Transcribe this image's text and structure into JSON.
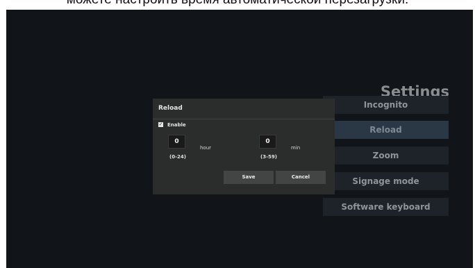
{
  "caption": "можете настроить время автоматической перезагрузки.",
  "settings": {
    "title": "Settings",
    "menu": [
      {
        "label": "Incognito",
        "active": false
      },
      {
        "label": "Reload",
        "active": true
      },
      {
        "label": "Zoom",
        "active": false
      },
      {
        "label": "Signage mode",
        "active": false
      },
      {
        "label": "Software keyboard",
        "active": false
      }
    ]
  },
  "dialog": {
    "title": "Reload",
    "enable_label": "Enable",
    "enabled": true,
    "hour": {
      "value": "0",
      "unit": "hour",
      "range": "(0-24)"
    },
    "minute": {
      "value": "0",
      "unit": "min",
      "range": "(3-59)"
    },
    "save_label": "Save",
    "cancel_label": "Cancel"
  },
  "colors": {
    "screen_bg": "#111418",
    "dialog_bg": "#2b2c2c",
    "menu_bg": "#1d2328",
    "menu_active_bg": "#2a3744"
  }
}
